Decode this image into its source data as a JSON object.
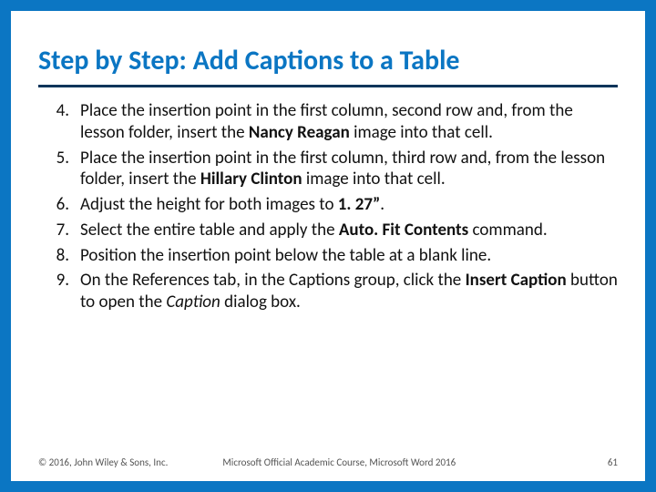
{
  "title": "Step by Step: Add Captions to a Table",
  "list_start": 4,
  "steps": {
    "s4a": "Place the insertion point in the first column, second row and, from the lesson folder, insert the ",
    "s4b": "Nancy Reagan",
    "s4c": " image into that cell.",
    "s5a": "Place the insertion point in the first column, third row and, from the lesson folder, insert the ",
    "s5b": "Hillary Clinton",
    "s5c": " image into that cell.",
    "s6a": "Adjust the height for both images to ",
    "s6b": "1. 27”",
    "s6c": ".",
    "s7a": "Select the entire table and apply the ",
    "s7b": "Auto. Fit Contents",
    "s7c": " command.",
    "s8": "Position the insertion point below the table at a blank line.",
    "s9a": "On the References tab, in the Captions group, click the ",
    "s9b": "Insert Caption",
    "s9c": " button to open the ",
    "s9d": "Caption",
    "s9e": " dialog box."
  },
  "footer": {
    "copyright": "© 2016, John Wiley & Sons, Inc.",
    "course": "Microsoft Official Academic Course, Microsoft Word 2016",
    "page": "61"
  }
}
